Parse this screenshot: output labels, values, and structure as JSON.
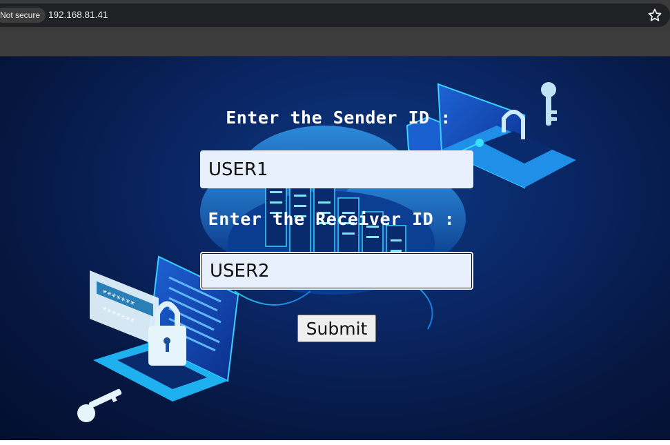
{
  "browser": {
    "security_label": "Not secure",
    "url": "192.168.81.41",
    "bookmark_icon": "star-icon"
  },
  "form": {
    "sender_label": "Enter the Sender ID :",
    "sender_value": "USER1",
    "receiver_label": "Enter the Receiver ID :",
    "receiver_value": "USER2",
    "submit_label": "Submit"
  },
  "background": {
    "illustration": "cyber-security cloud server illustration",
    "password_mask_1": "*******",
    "password_mask_2": "*******",
    "colors": {
      "primary": "#0a2766",
      "accent": "#2bd4f7"
    }
  }
}
